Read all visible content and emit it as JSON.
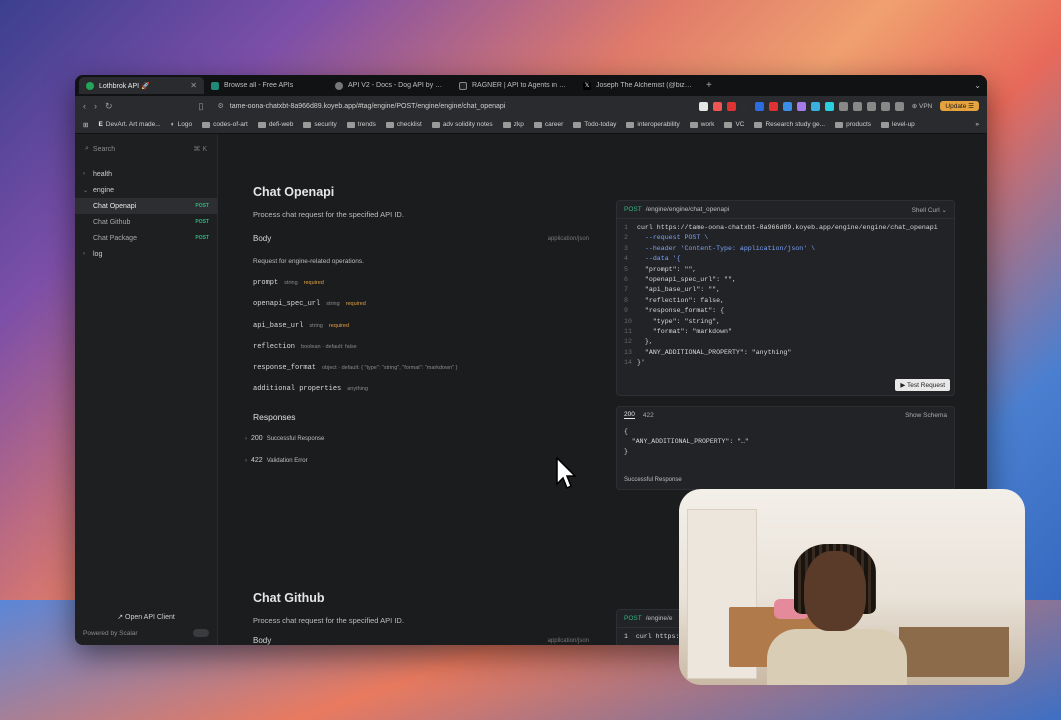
{
  "tabs": [
    {
      "title": "Lothbrok API 🚀",
      "active": true
    },
    {
      "title": "Browse all - Free APIs"
    },
    {
      "title": "API V2 - Docs - Dog API by kindu"
    },
    {
      "title": "RAGNER | API to Agents in minutes"
    },
    {
      "title": "Joseph The Alchemist (@bizmin"
    }
  ],
  "url": "tame-oona-chatxbt-8a966d89.koyeb.app/#tag/engine/POST/engine/engine/chat_openapi",
  "vpn_label": "VPN",
  "update_label": "Update",
  "bookmarks": [
    "DevArt. Art made...",
    "Logo",
    "codes-of-art",
    "defi-web",
    "security",
    "trends",
    "checklist",
    "adv solidity notes",
    "zkp",
    "career",
    "Todo-today",
    "interoperability",
    "work",
    "VC",
    "Research study ge...",
    "products",
    "level-up"
  ],
  "sidebar": {
    "search_placeholder": "Search",
    "search_kbd": "⌘ K",
    "items": [
      {
        "label": "health",
        "type": "group"
      },
      {
        "label": "engine",
        "type": "group-open"
      },
      {
        "label": "Chat Openapi",
        "method": "POST",
        "active": true
      },
      {
        "label": "Chat Github",
        "method": "POST"
      },
      {
        "label": "Chat Package",
        "method": "POST"
      },
      {
        "label": "log",
        "type": "group"
      }
    ],
    "open_client": "↗ Open API Client",
    "powered_by": "Powered by Scalar"
  },
  "endpoint1": {
    "title": "Chat Openapi",
    "description": "Process chat request for the specified API ID.",
    "body_label": "Body",
    "content_type": "application/json",
    "body_note": "Request for engine-related operations.",
    "params": [
      {
        "name": "prompt",
        "type": "string",
        "req": "required"
      },
      {
        "name": "openapi_spec_url",
        "type": "string",
        "req": "required"
      },
      {
        "name": "api_base_url",
        "type": "string",
        "req": "required"
      },
      {
        "name": "reflection",
        "type": "boolean · default: false",
        "req": ""
      },
      {
        "name": "response_format",
        "type": "object · default: { \"type\": \"string\", \"format\": \"markdown\" }",
        "req": ""
      },
      {
        "name": "additional properties",
        "type": "anything",
        "req": ""
      }
    ],
    "responses_label": "Responses",
    "responses": [
      {
        "code": "200",
        "msg": "Successful Response"
      },
      {
        "code": "422",
        "msg": "Validation Error"
      }
    ]
  },
  "code_card": {
    "method": "POST",
    "path": "/engine/engine/chat_openapi",
    "lang": "Shell Curl ⌄",
    "lines": [
      "curl https://tame-oona-chatxbt-8a966d89.koyeb.app/engine/engine/chat_openapi",
      "  --request POST \\",
      "  --header 'Content-Type: application/json' \\",
      "  --data '{",
      "  \"prompt\": \"\",",
      "  \"openapi_spec_url\": \"\",",
      "  \"api_base_url\": \"\",",
      "  \"reflection\": false,",
      "  \"response_format\": {",
      "    \"type\": \"string\",",
      "    \"format\": \"markdown\"",
      "  },",
      "  \"ANY_ADDITIONAL_PROPERTY\": \"anything\"",
      "}'"
    ],
    "test_button": "▶ Test Request"
  },
  "resp_card": {
    "tab1": "200",
    "tab2": "422",
    "show_schema": "Show Schema",
    "json": "{\n  \"ANY_ADDITIONAL_PROPERTY\": \"…\"\n}",
    "footer": "Successful Response"
  },
  "endpoint2": {
    "title": "Chat Github",
    "description": "Process chat request for the specified API ID.",
    "body_label": "Body",
    "content_type": "application/json",
    "code_method": "POST",
    "code_path": "/engine/e",
    "code_line": "1  curl https:"
  }
}
